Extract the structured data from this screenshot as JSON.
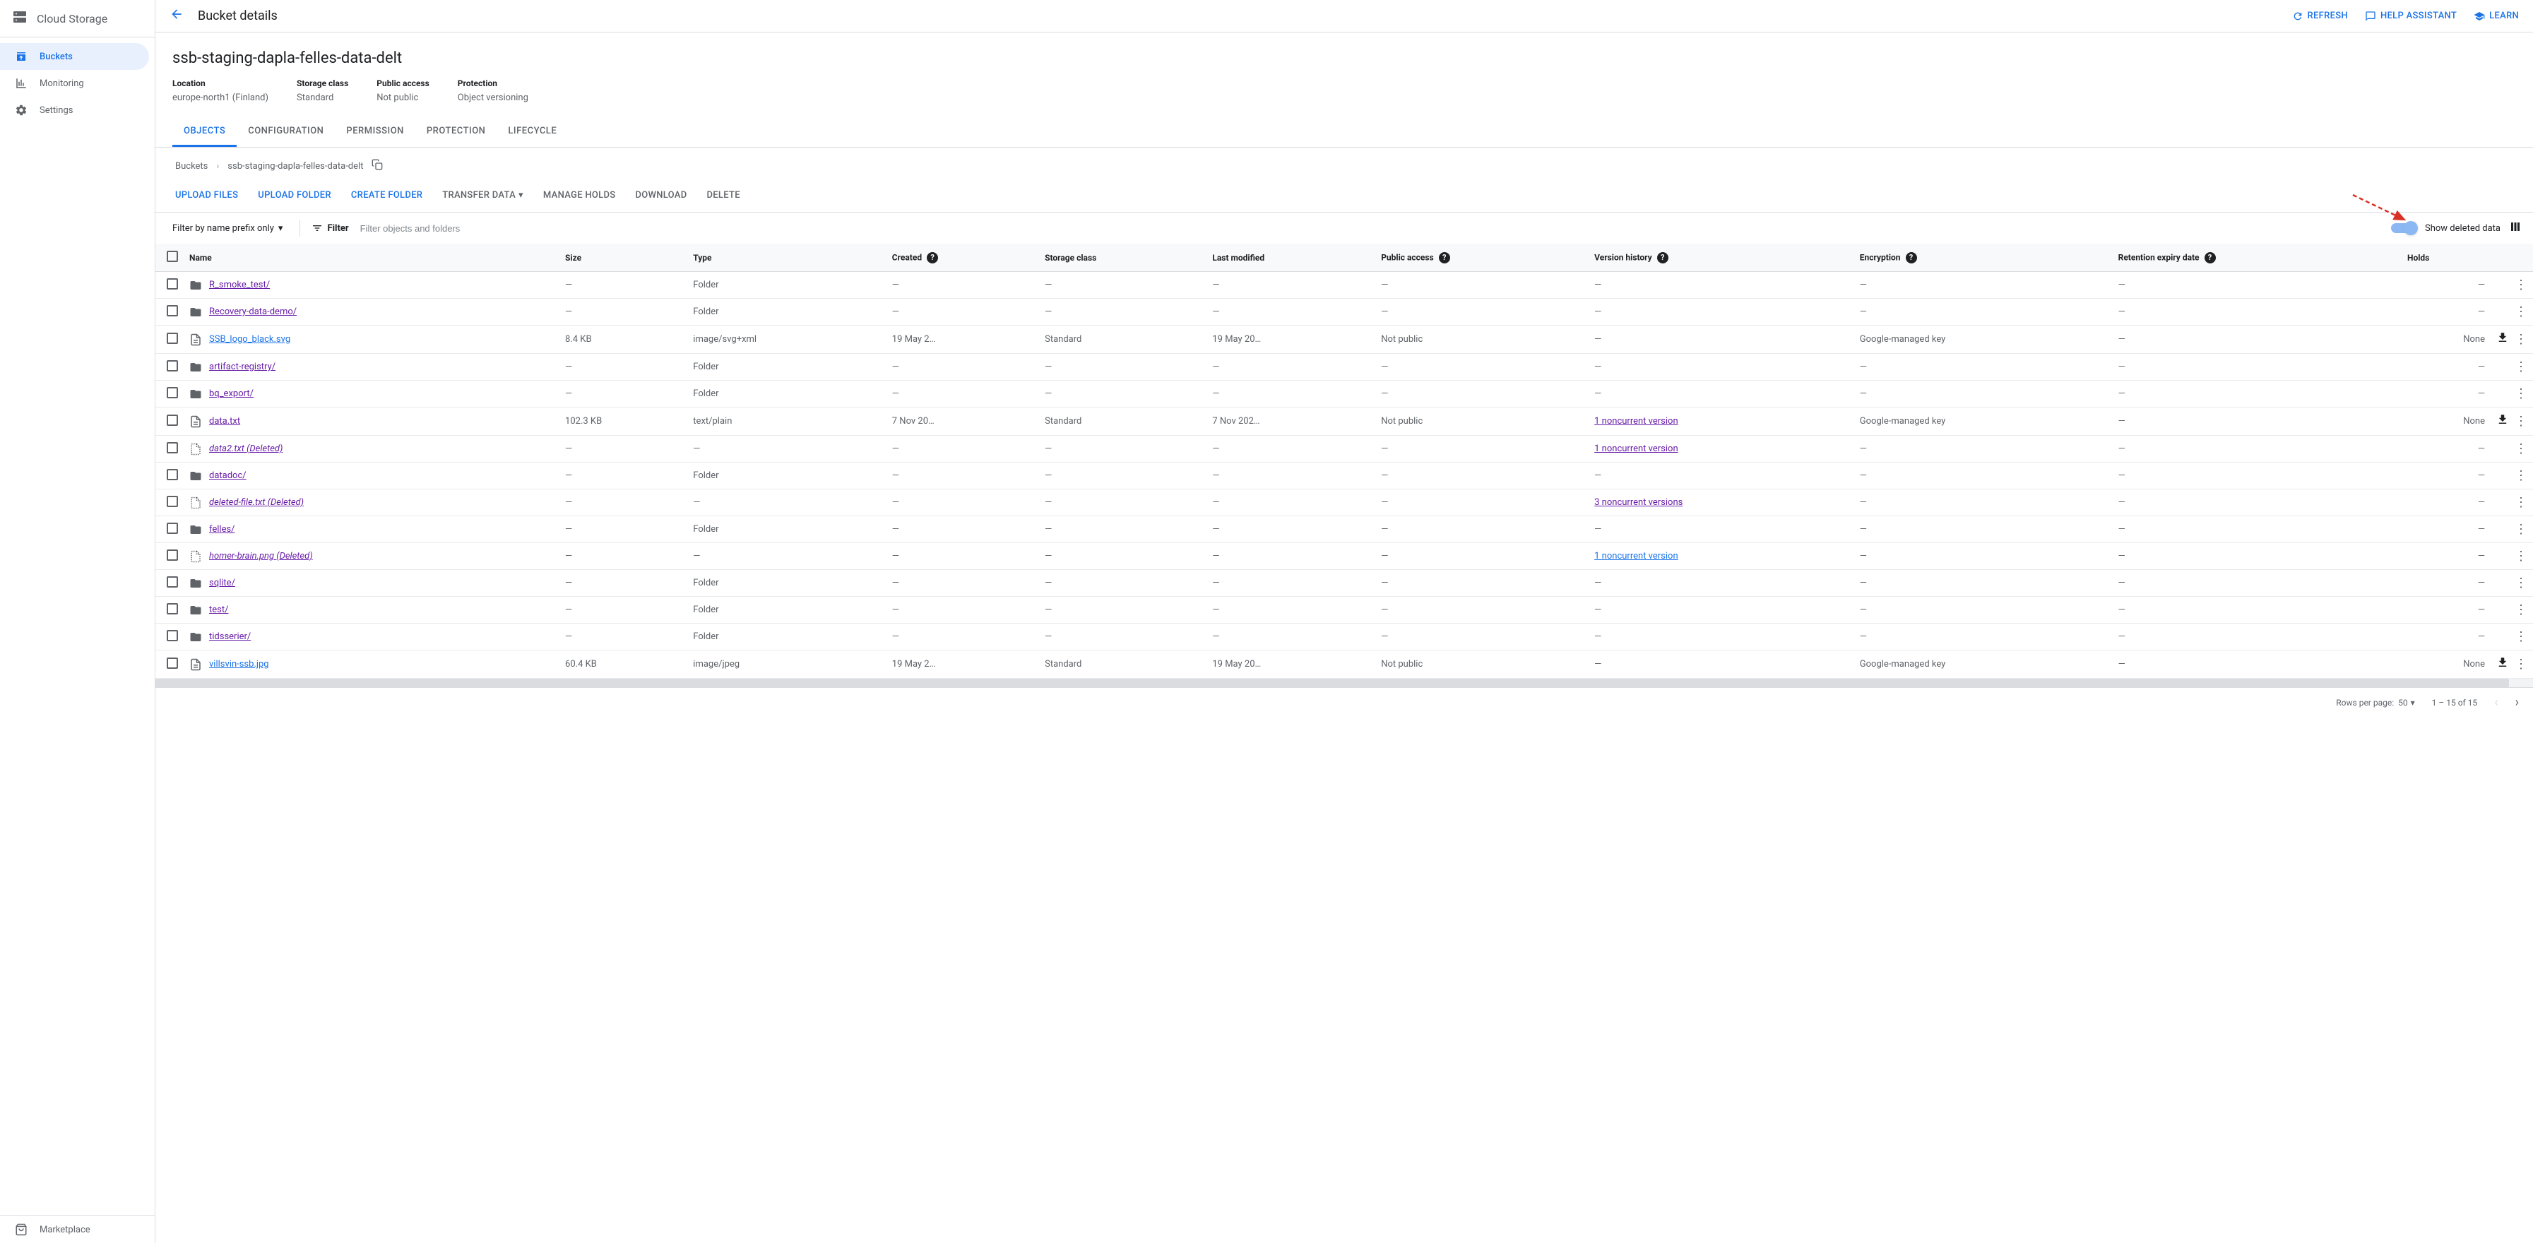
{
  "sidebar": {
    "title": "Cloud Storage",
    "items": [
      {
        "label": "Buckets",
        "icon": "archive"
      },
      {
        "label": "Monitoring",
        "icon": "chart"
      },
      {
        "label": "Settings",
        "icon": "gear"
      }
    ],
    "footer": "Marketplace"
  },
  "topbar": {
    "title": "Bucket details",
    "actions": {
      "refresh": "REFRESH",
      "help": "HELP ASSISTANT",
      "learn": "LEARN"
    }
  },
  "bucket": {
    "name": "ssb-staging-dapla-felles-data-delt",
    "meta": [
      {
        "label": "Location",
        "value": "europe-north1 (Finland)"
      },
      {
        "label": "Storage class",
        "value": "Standard"
      },
      {
        "label": "Public access",
        "value": "Not public"
      },
      {
        "label": "Protection",
        "value": "Object versioning"
      }
    ]
  },
  "tabs": [
    "OBJECTS",
    "CONFIGURATION",
    "PERMISSION",
    "PROTECTION",
    "LIFECYCLE"
  ],
  "breadcrumb": {
    "root": "Buckets",
    "current": "ssb-staging-dapla-felles-data-delt"
  },
  "actions": {
    "upload_files": "UPLOAD FILES",
    "upload_folder": "UPLOAD FOLDER",
    "create_folder": "CREATE FOLDER",
    "transfer_data": "TRANSFER DATA",
    "manage_holds": "MANAGE HOLDS",
    "download": "DOWNLOAD",
    "delete": "DELETE"
  },
  "filter": {
    "dropdown": "Filter by name prefix only",
    "label": "Filter",
    "placeholder": "Filter objects and folders",
    "toggle_label": "Show deleted data"
  },
  "columns": [
    "Name",
    "Size",
    "Type",
    "Created",
    "Storage class",
    "Last modified",
    "Public access",
    "Version history",
    "Encryption",
    "Retention expiry date",
    "Holds"
  ],
  "rows": [
    {
      "name": "R_smoke_test/",
      "kind": "folder",
      "visited": true,
      "size": "—",
      "type": "Folder",
      "created": "—",
      "storage": "—",
      "modified": "—",
      "public": "—",
      "version": "—",
      "encryption": "—",
      "retention": "—",
      "holds": "—",
      "download": false
    },
    {
      "name": "Recovery-data-demo/",
      "kind": "folder",
      "visited": true,
      "size": "—",
      "type": "Folder",
      "created": "—",
      "storage": "—",
      "modified": "—",
      "public": "—",
      "version": "—",
      "encryption": "—",
      "retention": "—",
      "holds": "—",
      "download": false
    },
    {
      "name": "SSB_logo_black.svg",
      "kind": "file",
      "visited": false,
      "size": "8.4 KB",
      "type": "image/svg+xml",
      "created": "19 May 2…",
      "storage": "Standard",
      "modified": "19 May 20…",
      "public": "Not public",
      "version": "—",
      "encryption": "Google-managed key",
      "retention": "—",
      "holds": "None",
      "download": true
    },
    {
      "name": "artifact-registry/",
      "kind": "folder",
      "visited": true,
      "size": "—",
      "type": "Folder",
      "created": "—",
      "storage": "—",
      "modified": "—",
      "public": "—",
      "version": "—",
      "encryption": "—",
      "retention": "—",
      "holds": "—",
      "download": false
    },
    {
      "name": "bq_export/",
      "kind": "folder",
      "visited": true,
      "size": "—",
      "type": "Folder",
      "created": "—",
      "storage": "—",
      "modified": "—",
      "public": "—",
      "version": "—",
      "encryption": "—",
      "retention": "—",
      "holds": "—",
      "download": false
    },
    {
      "name": "data.txt",
      "kind": "file",
      "visited": true,
      "size": "102.3 KB",
      "type": "text/plain",
      "created": "7 Nov 20…",
      "storage": "Standard",
      "modified": "7 Nov 202…",
      "public": "Not public",
      "version": "1 noncurrent version",
      "version_visited": true,
      "encryption": "Google-managed key",
      "retention": "—",
      "holds": "None",
      "download": true
    },
    {
      "name": "data2.txt (Deleted)",
      "kind": "deleted",
      "visited": true,
      "size": "—",
      "type": "—",
      "created": "—",
      "storage": "—",
      "modified": "—",
      "public": "—",
      "version": "1 noncurrent version",
      "version_visited": true,
      "encryption": "—",
      "retention": "—",
      "holds": "—",
      "download": false
    },
    {
      "name": "datadoc/",
      "kind": "folder",
      "visited": true,
      "size": "—",
      "type": "Folder",
      "created": "—",
      "storage": "—",
      "modified": "—",
      "public": "—",
      "version": "—",
      "encryption": "—",
      "retention": "—",
      "holds": "—",
      "download": false
    },
    {
      "name": "deleted-file.txt (Deleted)",
      "kind": "deleted",
      "visited": true,
      "size": "—",
      "type": "—",
      "created": "—",
      "storage": "—",
      "modified": "—",
      "public": "—",
      "version": "3 noncurrent versions",
      "version_visited": true,
      "encryption": "—",
      "retention": "—",
      "holds": "—",
      "download": false
    },
    {
      "name": "felles/",
      "kind": "folder",
      "visited": true,
      "size": "—",
      "type": "Folder",
      "created": "—",
      "storage": "—",
      "modified": "—",
      "public": "—",
      "version": "—",
      "encryption": "—",
      "retention": "—",
      "holds": "—",
      "download": false
    },
    {
      "name": "homer-brain.png (Deleted)",
      "kind": "deleted",
      "visited": true,
      "size": "—",
      "type": "—",
      "created": "—",
      "storage": "—",
      "modified": "—",
      "public": "—",
      "version": "1 noncurrent version",
      "version_visited": false,
      "encryption": "—",
      "retention": "—",
      "holds": "—",
      "download": false
    },
    {
      "name": "sqlite/",
      "kind": "folder",
      "visited": true,
      "size": "—",
      "type": "Folder",
      "created": "—",
      "storage": "—",
      "modified": "—",
      "public": "—",
      "version": "—",
      "encryption": "—",
      "retention": "—",
      "holds": "—",
      "download": false
    },
    {
      "name": "test/",
      "kind": "folder",
      "visited": true,
      "size": "—",
      "type": "Folder",
      "created": "—",
      "storage": "—",
      "modified": "—",
      "public": "—",
      "version": "—",
      "encryption": "—",
      "retention": "—",
      "holds": "—",
      "download": false
    },
    {
      "name": "tidsserier/",
      "kind": "folder",
      "visited": true,
      "size": "—",
      "type": "Folder",
      "created": "—",
      "storage": "—",
      "modified": "—",
      "public": "—",
      "version": "—",
      "encryption": "—",
      "retention": "—",
      "holds": "—",
      "download": false
    },
    {
      "name": "villsvin-ssb.jpg",
      "kind": "file",
      "visited": false,
      "size": "60.4 KB",
      "type": "image/jpeg",
      "created": "19 May 2…",
      "storage": "Standard",
      "modified": "19 May 20…",
      "public": "Not public",
      "version": "—",
      "encryption": "Google-managed key",
      "retention": "—",
      "holds": "None",
      "download": true
    }
  ],
  "pagination": {
    "rows_label": "Rows per page:",
    "rows_value": "50",
    "range": "1 – 15 of 15"
  }
}
